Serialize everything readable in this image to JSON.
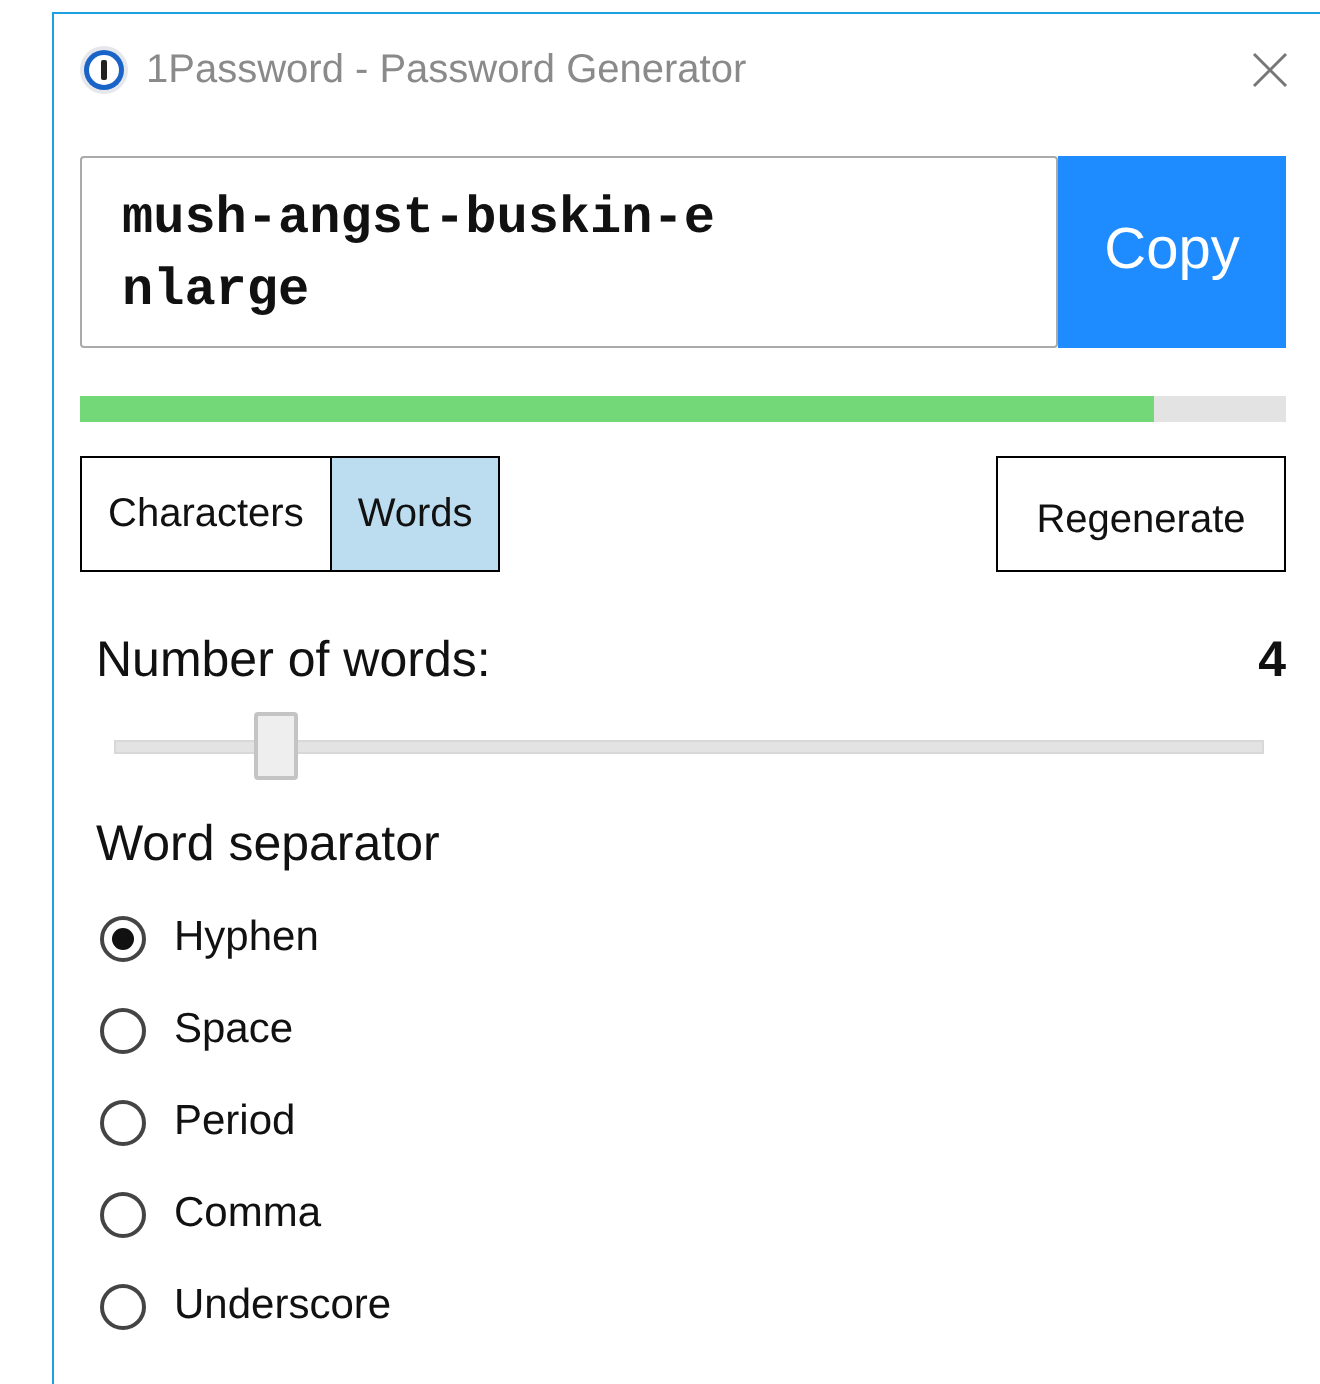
{
  "window": {
    "title": "1Password - Password Generator"
  },
  "password": {
    "value": "mush-angst-buskin-enlarge"
  },
  "copy_button": "Copy",
  "strength": {
    "level": 0.89
  },
  "tabs": [
    {
      "label": "Characters",
      "selected": false
    },
    {
      "label": "Words",
      "selected": true
    }
  ],
  "regenerate_button": "Regenerate",
  "word_count": {
    "label": "Number of words:",
    "value": "4",
    "level": 0.14
  },
  "separator": {
    "label": "Word separator",
    "options": [
      {
        "label": "Hyphen",
        "selected": true
      },
      {
        "label": "Space",
        "selected": false
      },
      {
        "label": "Period",
        "selected": false
      },
      {
        "label": "Comma",
        "selected": false
      },
      {
        "label": "Underscore",
        "selected": false
      }
    ]
  }
}
